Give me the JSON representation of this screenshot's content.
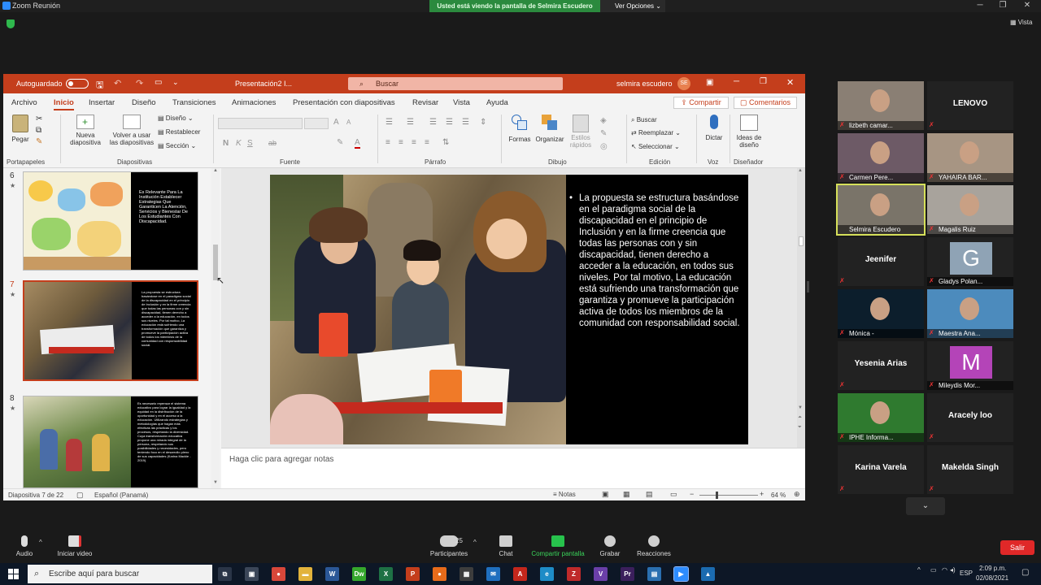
{
  "zoom": {
    "window_title": "Zoom Reunión",
    "share_banner": "Usted está viendo la pantalla de Selmira Escudero",
    "view_options": "Ver Opciones",
    "view_label": "Vista"
  },
  "ppt": {
    "autosave_label": "Autoguardado",
    "doc_title": "Presentación2 I...",
    "search_placeholder": "Buscar",
    "user_name": "selmira escudero",
    "user_initials": "SE",
    "tabs": [
      "Archivo",
      "Inicio",
      "Insertar",
      "Diseño",
      "Transiciones",
      "Animaciones",
      "Presentación con diapositivas",
      "Revisar",
      "Vista",
      "Ayuda"
    ],
    "active_tab": "Inicio",
    "share_label": "Compartir",
    "comments_label": "Comentarios",
    "groups": {
      "portapapeles": "Portapapeles",
      "diapositivas": "Diapositivas",
      "fuente": "Fuente",
      "parrafo": "Párrafo",
      "dibujo": "Dibujo",
      "edicion": "Edición",
      "voz": "Voz",
      "disenador": "Diseñador"
    },
    "buttons": {
      "pegar": "Pegar",
      "nueva_line1": "Nueva",
      "nueva_line2": "diapositiva",
      "volver_line1": "Volver a usar",
      "volver_line2": "las diapositivas",
      "diseno": "Diseño",
      "restablecer": "Restablecer",
      "seccion": "Sección",
      "formas": "Formas",
      "organizar": "Organizar",
      "estilos_line1": "Estilos",
      "estilos_line2": "rápidos",
      "buscar": "Buscar",
      "reemplazar": "Reemplazar",
      "seleccionar": "Seleccionar",
      "dictar": "Dictar",
      "ideas_line1": "Ideas de",
      "ideas_line2": "diseño"
    },
    "font_letters": [
      "N",
      "K",
      "S",
      "ab",
      "A"
    ],
    "thumbnails": [
      {
        "num": "6",
        "text": "Es Relevante Para La Institución Establecer Estrategias Que Garanticen La Atención, Servicios y Bienestar De Los Estudiantes Con Discapacidad."
      },
      {
        "num": "7",
        "text": "La propuesta se estructura basándose en el paradigma social de la discapacidad en el principio de Inclusión y en la firme creencia que todas las personas con y sin discapacidad, tienen derecho a acceder a la educación, en todos sus niveles. Por tal motivo, La educación está sufriendo una transformación que garantiza y promueve la participación activa de todos los miembros de la comunidad con responsabilidad social."
      },
      {
        "num": "8",
        "text": "Es necesario repensar el sistema educativo para lograr la igualdad y la equidad en la distribución de la oportunidad y en el acceso a la educación. Utilizando estrategias y metodologías que hagan más efectivas las prácticas y los procesos, respetando la diversidad. Cuya transformación educativa propone una mirada integral de la persona, respetando sus posibilidades y necesidades, pero teniendo foco en el desarrollo pleno de sus capacidades (Karina Mackie - 2019)."
      }
    ],
    "selected_slide_index": 1,
    "slide_text": "La propuesta se estructura basándose en el paradigma social de la discapacidad en el principio de Inclusión y en la firme creencia que todas las personas con y sin discapacidad, tienen derecho a acceder a la educación, en todos sus niveles.  Por tal motivo, La educación está sufriendo una transformación que garantiza y promueve la participación activa de todos los miembros de la comunidad con responsabilidad social.",
    "notes_placeholder": "Haga clic para agregar notas",
    "status": {
      "slide_counter": "Diapositiva 7 de 22",
      "language": "Español (Panamá)",
      "notes": "Notas",
      "zoom": "64 %"
    }
  },
  "participants": [
    {
      "name": "lizbeth camar...",
      "type": "video",
      "bg": "#8a7f74"
    },
    {
      "name": "LENOVO",
      "type": "name"
    },
    {
      "name": "Carmen Pere...",
      "type": "video",
      "bg": "#6d5a66"
    },
    {
      "name": "YAHAIRA BAR...",
      "type": "video",
      "bg": "#a79583"
    },
    {
      "name": "Selmira Escudero",
      "type": "video",
      "bg": "#7a7469",
      "speaker": true
    },
    {
      "name": "Magalis Ruiz",
      "type": "video",
      "bg": "#a8a39c"
    },
    {
      "name": "Jeenifer",
      "type": "name"
    },
    {
      "name": "Gladys Polan...",
      "type": "letter",
      "letter": "G",
      "bg": "#8fa3b5"
    },
    {
      "name": "Mónica -",
      "type": "video",
      "bg": "#0c1e2c"
    },
    {
      "name": "Maestra Ana...",
      "type": "video",
      "bg": "#4c8bbd"
    },
    {
      "name": "Yesenia Arias",
      "type": "name"
    },
    {
      "name": "Mileydis Mor...",
      "type": "letter",
      "letter": "M",
      "bg": "#b444b8"
    },
    {
      "name": "IPHE Informa...",
      "type": "video",
      "bg": "#2f7a2f"
    },
    {
      "name": "Aracely loo",
      "type": "name"
    },
    {
      "name": "Karina Varela",
      "type": "name"
    },
    {
      "name": "Makelda Singh",
      "type": "name"
    }
  ],
  "toolbar": {
    "audio": "Audio",
    "video": "Iniciar video",
    "participants": "Participantes",
    "participants_count": "25",
    "chat": "Chat",
    "share": "Compartir pantalla",
    "record": "Grabar",
    "reactions": "Reacciones",
    "leave": "Salir"
  },
  "taskbar": {
    "search_placeholder": "Escribe aquí para buscar",
    "lang": "ESP",
    "time": "2:09 p.m.",
    "date": "02/08/2021",
    "apps": [
      {
        "icon": "task-view-icon",
        "label": "⧉",
        "color": "#2a3547"
      },
      {
        "icon": "store-icon",
        "label": "▣",
        "color": "#3b4658"
      },
      {
        "icon": "chrome-icon",
        "label": "●",
        "color": "#d8473a"
      },
      {
        "icon": "folder-icon",
        "label": "▬",
        "color": "#e2b33c"
      },
      {
        "icon": "word-icon",
        "label": "W",
        "color": "#2b5797"
      },
      {
        "icon": "dreamweaver-icon",
        "label": "Dw",
        "color": "#35a82c"
      },
      {
        "icon": "excel-icon",
        "label": "X",
        "color": "#1e7145"
      },
      {
        "icon": "powerpoint-icon",
        "label": "P",
        "color": "#c43e1c"
      },
      {
        "icon": "firefox-icon",
        "label": "●",
        "color": "#e76b1a"
      },
      {
        "icon": "app-icon",
        "label": "▦",
        "color": "#3d3d3d"
      },
      {
        "icon": "mail-icon",
        "label": "✉",
        "color": "#1f6fbf"
      },
      {
        "icon": "acrobat-icon",
        "label": "A",
        "color": "#c4271c"
      },
      {
        "icon": "edge-icon",
        "label": "e",
        "color": "#1e8cc7"
      },
      {
        "icon": "filezilla-icon",
        "label": "Z",
        "color": "#bf2a2a"
      },
      {
        "icon": "visual-studio-icon",
        "label": "V",
        "color": "#6a3fa8"
      },
      {
        "icon": "premiere-icon",
        "label": "Pr",
        "color": "#3b1f5c"
      },
      {
        "icon": "doc-icon",
        "label": "▤",
        "color": "#2a6fb0"
      },
      {
        "icon": "zoom-icon",
        "label": "▶",
        "color": "#2d8cff"
      },
      {
        "icon": "photos-icon",
        "label": "▲",
        "color": "#1b6bb0"
      }
    ]
  }
}
